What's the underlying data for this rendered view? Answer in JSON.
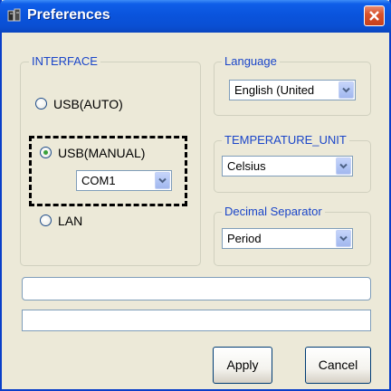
{
  "window": {
    "title": "Preferences"
  },
  "interface": {
    "legend": "INTERFACE",
    "options": [
      {
        "label": "USB(AUTO)",
        "selected": false
      },
      {
        "label": "USB(MANUAL)",
        "selected": true
      },
      {
        "label": "LAN",
        "selected": false
      }
    ],
    "com_port": "COM1"
  },
  "language": {
    "legend": "Language",
    "value": "English (United"
  },
  "temperature_unit": {
    "legend": "TEMPERATURE_UNIT",
    "value": "Celsius"
  },
  "decimal_separator": {
    "legend": "Decimal Separator",
    "value": "Period"
  },
  "fields": {
    "field1": "",
    "field2": ""
  },
  "buttons": {
    "apply": "Apply",
    "cancel": "Cancel"
  },
  "colors": {
    "title_bar": "#0a54dd",
    "group_legend": "#1b46c9",
    "dialog_bg": "#ece9d8",
    "radio_selected": "#3aa13a"
  }
}
